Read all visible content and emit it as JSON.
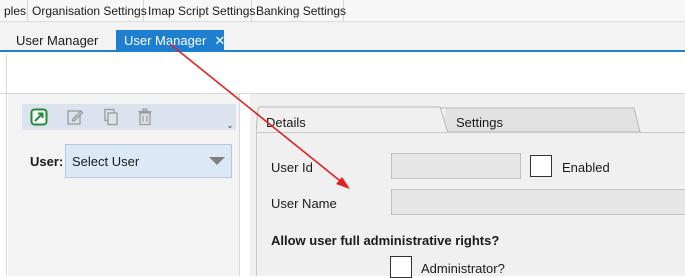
{
  "menu": {
    "items": [
      {
        "label": "ples"
      },
      {
        "label": "Organisation Settings"
      },
      {
        "label": "Imap Script Settings"
      },
      {
        "label": "Banking Settings"
      }
    ]
  },
  "doc_tabs": [
    {
      "label": "User Manager",
      "active": false
    },
    {
      "label": "User Manager",
      "active": true,
      "close": "✕"
    }
  ],
  "toolbar": {
    "icons": [
      "export-icon",
      "edit-icon",
      "copy-icon",
      "delete-icon"
    ],
    "overflow_glyph": "⌄"
  },
  "user_selector": {
    "label": "User:",
    "value": "Select User"
  },
  "detail_tabs": [
    {
      "label": "Details",
      "active": true
    },
    {
      "label": "Settings",
      "active": false
    }
  ],
  "details": {
    "user_id_label": "User Id",
    "user_id_value": "",
    "enabled_label": "Enabled",
    "user_name_label": "User Name",
    "user_name_value": "",
    "admin_heading": "Allow user full administrative rights?",
    "administrator_label": "Administrator?"
  },
  "colors": {
    "accent": "#1e7fd1",
    "select_bg": "#dbe9f7",
    "annotation_arrow": "#e02020"
  }
}
